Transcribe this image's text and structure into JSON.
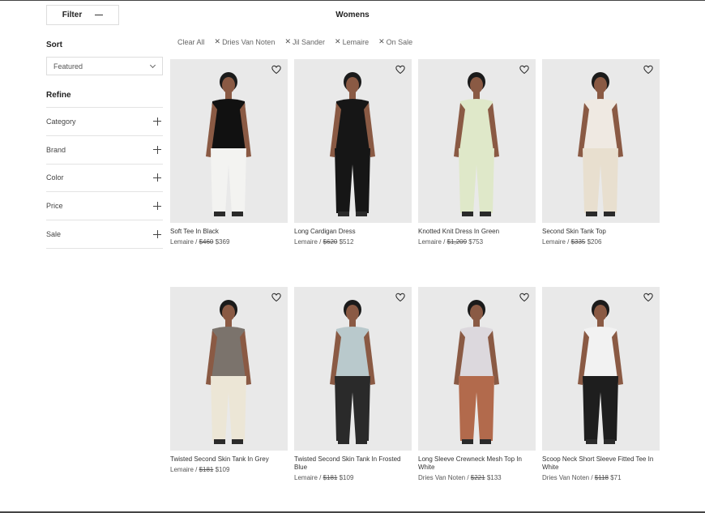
{
  "header": {
    "filter_label": "Filter",
    "page_title": "Womens"
  },
  "sidebar": {
    "sort_heading": "Sort",
    "sort_value": "Featured",
    "refine_heading": "Refine",
    "refine_items": [
      {
        "label": "Category"
      },
      {
        "label": "Brand"
      },
      {
        "label": "Color"
      },
      {
        "label": "Price"
      },
      {
        "label": "Sale"
      }
    ]
  },
  "filters": {
    "clear_all": "Clear All",
    "chips": [
      "Dries Van Noten",
      "Jil Sander",
      "Lemaire",
      "On Sale"
    ]
  },
  "products": [
    {
      "name": "Soft Tee In Black",
      "brand": "Lemaire",
      "old_price": "$460",
      "price": "$369",
      "top": "#111111",
      "bottom": "#f3f3f1"
    },
    {
      "name": "Long Cardigan Dress",
      "brand": "Lemaire",
      "old_price": "$620",
      "price": "$512",
      "top": "#161616",
      "bottom": "#161616"
    },
    {
      "name": "Knotted Knit Dress In Green",
      "brand": "Lemaire",
      "old_price": "$1,209",
      "price": "$753",
      "top": "#dfe8c9",
      "bottom": "#dfe8c9"
    },
    {
      "name": "Second Skin Tank Top",
      "brand": "Lemaire",
      "old_price": "$335",
      "price": "$206",
      "top": "#efe9e2",
      "bottom": "#e8dfcf"
    },
    {
      "name": "Twisted Second Skin Tank In Grey",
      "brand": "Lemaire",
      "old_price": "$181",
      "price": "$109",
      "top": "#7b736c",
      "bottom": "#ece6d6"
    },
    {
      "name": "Twisted Second Skin Tank In Frosted Blue",
      "brand": "Lemaire",
      "old_price": "$181",
      "price": "$109",
      "top": "#b9c9cc",
      "bottom": "#2a2a2a"
    },
    {
      "name": "Long Sleeve Crewneck Mesh Top In White",
      "brand": "Dries Van Noten",
      "old_price": "$221",
      "price": "$133",
      "top": "#dcd8dd",
      "bottom": "#b26a4c"
    },
    {
      "name": "Scoop Neck Short Sleeve Fitted Tee In White",
      "brand": "Dries Van Noten",
      "old_price": "$118",
      "price": "$71",
      "top": "#f2f2f2",
      "bottom": "#1e1e1e"
    }
  ]
}
